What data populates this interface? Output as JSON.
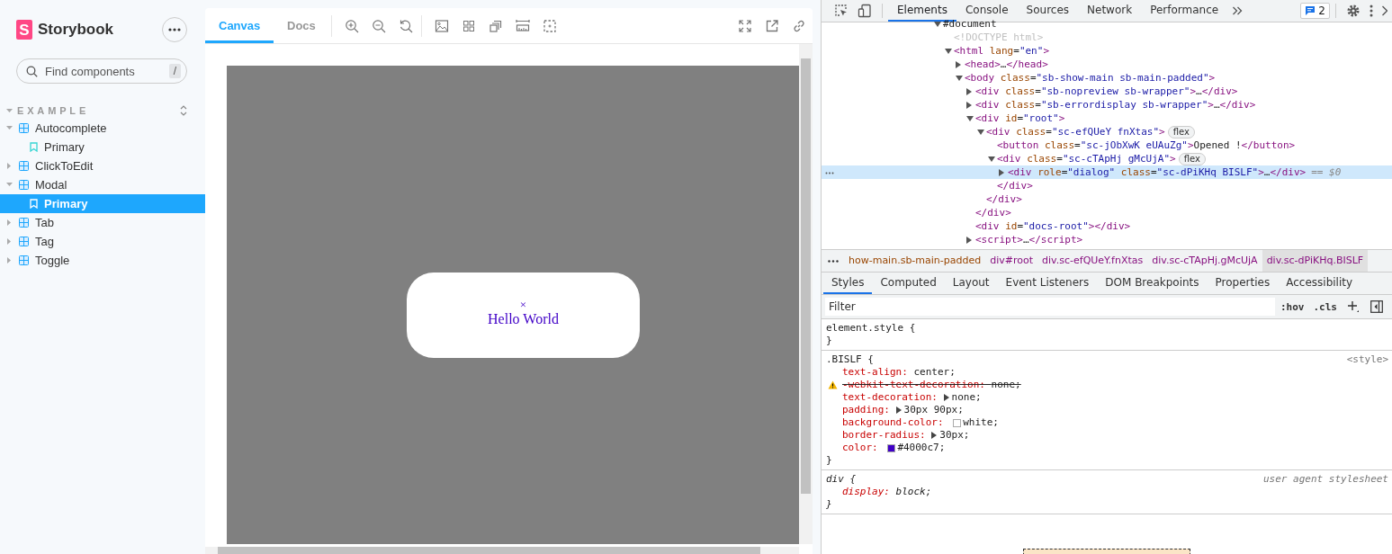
{
  "sidebar": {
    "logo_mark": "S",
    "brand": "Storybook",
    "search": {
      "placeholder": "Find components",
      "shortcut": "/"
    },
    "section": {
      "label": "EXAMPLE",
      "expanded": true,
      "items": [
        {
          "label": "Autocomplete",
          "expanded": true,
          "children": [
            {
              "label": "Primary",
              "selected": false
            }
          ]
        },
        {
          "label": "ClickToEdit",
          "expanded": false
        },
        {
          "label": "Modal",
          "expanded": true,
          "children": [
            {
              "label": "Primary",
              "selected": true
            }
          ]
        },
        {
          "label": "Tab",
          "expanded": false
        },
        {
          "label": "Tag",
          "expanded": false
        },
        {
          "label": "Toggle",
          "expanded": false
        }
      ]
    }
  },
  "preview": {
    "tabs": [
      {
        "label": "Canvas",
        "selected": true
      },
      {
        "label": "Docs",
        "selected": false
      }
    ],
    "modal": {
      "close": "×",
      "text": "Hello World"
    }
  },
  "devtools": {
    "tabs": [
      {
        "label": "Elements",
        "selected": true
      },
      {
        "label": "Console",
        "selected": false
      },
      {
        "label": "Sources",
        "selected": false
      },
      {
        "label": "Network",
        "selected": false
      },
      {
        "label": "Performance",
        "selected": false
      }
    ],
    "issues_count": "2",
    "dom": {
      "kind": "document",
      "text": "#document",
      "expanded": true,
      "selected": false,
      "children": [
        {
          "kind": "doctype",
          "text": "<!DOCTYPE html>",
          "selected": false
        },
        {
          "kind": "element",
          "text": "<html lang=\"en\">",
          "expanded": true,
          "selected": false,
          "children": [
            {
              "kind": "element",
              "text": "<head>…</head>",
              "expanded": false,
              "selected": false
            },
            {
              "kind": "element",
              "text": "<body class=\"sb-show-main sb-main-padded\">",
              "expanded": true,
              "selected": false,
              "children": [
                {
                  "kind": "element",
                  "text": "<div class=\"sb-nopreview sb-wrapper\">…</div>",
                  "expanded": false,
                  "selected": false
                },
                {
                  "kind": "element",
                  "text": "<div class=\"sb-errordisplay sb-wrapper\">…</div>",
                  "expanded": false,
                  "selected": false
                },
                {
                  "kind": "element",
                  "text": "<div id=\"root\">",
                  "expanded": true,
                  "selected": false,
                  "close": "</div>",
                  "children": [
                    {
                      "kind": "element",
                      "text": "<div class=\"sc-efQUeY fnXtas\">",
                      "badge": "flex",
                      "expanded": true,
                      "selected": false,
                      "close": "</div>",
                      "children": [
                        {
                          "kind": "element",
                          "text": "<button class=\"sc-jObXwK eUAuZg\">Opened !</button>",
                          "selected": false
                        },
                        {
                          "kind": "element",
                          "text": "<div class=\"sc-cTApHj gMcUjA\">",
                          "badge": "flex",
                          "expanded": true,
                          "selected": false,
                          "close": "</div>",
                          "children": [
                            {
                              "kind": "element",
                              "text": "<div role=\"dialog\" class=\"sc-dPiKHq BISLF\">…</div>",
                              "suffix": "== $0",
                              "expanded": false,
                              "selected": true
                            }
                          ]
                        }
                      ]
                    }
                  ]
                },
                {
                  "kind": "element",
                  "text": "<div id=\"docs-root\"></div>",
                  "selected": false
                },
                {
                  "kind": "element",
                  "text": "<script>…</script>",
                  "expanded": false,
                  "selected": false
                }
              ]
            }
          ]
        }
      ]
    },
    "breadcrumbs": [
      {
        "label": "how-main.sb-main-padded",
        "selected": false
      },
      {
        "label": "div#root",
        "selected": false
      },
      {
        "label": "div.sc-efQUeY.fnXtas",
        "selected": false
      },
      {
        "label": "div.sc-cTApHj.gMcUjA",
        "selected": false
      },
      {
        "label": "div.sc-dPiKHq.BISLF",
        "selected": true
      }
    ],
    "style_tabs": [
      {
        "label": "Styles",
        "selected": true
      },
      {
        "label": "Computed",
        "selected": false
      },
      {
        "label": "Layout",
        "selected": false
      },
      {
        "label": "Event Listeners",
        "selected": false
      },
      {
        "label": "DOM Breakpoints",
        "selected": false
      },
      {
        "label": "Properties",
        "selected": false
      },
      {
        "label": "Accessibility",
        "selected": false
      }
    ],
    "filter": {
      "placeholder": "Filter",
      "hov": ":hov",
      "cls": ".cls"
    },
    "rules": [
      {
        "kind": "inline",
        "selector": "element.style {",
        "close": "}"
      },
      {
        "kind": "author",
        "selector": ".BISLF {",
        "source": "<style>",
        "close": "}",
        "properties": [
          {
            "name": "text-align:",
            "value": "center;",
            "overridden": false,
            "expandable": false
          },
          {
            "name": "-webkit-text-decoration:",
            "value": "none;",
            "overridden": true,
            "expandable": false
          },
          {
            "name": "text-decoration:",
            "value": "none;",
            "overridden": false,
            "expandable": true
          },
          {
            "name": "padding:",
            "value": "30px 90px;",
            "overridden": false,
            "expandable": true
          },
          {
            "name": "background-color:",
            "value": "white;",
            "overridden": false,
            "expandable": false,
            "color": "#ffffff"
          },
          {
            "name": "border-radius:",
            "value": "30px;",
            "overridden": false,
            "expandable": true
          },
          {
            "name": "color:",
            "value": "#4000c7;",
            "overridden": false,
            "expandable": false,
            "color": "#4000c7"
          }
        ]
      },
      {
        "kind": "user-agent",
        "selector": "div {",
        "source": "user agent stylesheet",
        "close": "}",
        "properties": [
          {
            "name": "display:",
            "value": "block;",
            "overridden": false,
            "expandable": false
          }
        ]
      }
    ]
  }
}
